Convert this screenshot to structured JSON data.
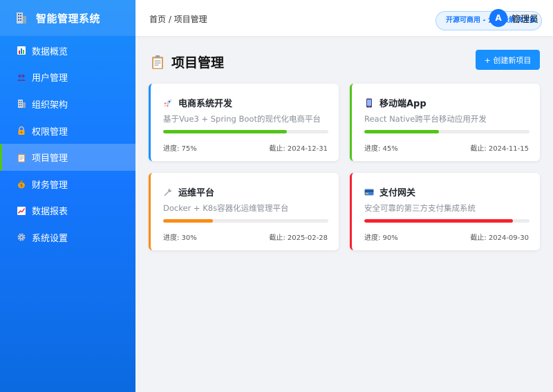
{
  "sidebar": {
    "title": "智能管理系统",
    "items": [
      {
        "label": "数据概览",
        "icon": "bar-chart-icon",
        "active": false
      },
      {
        "label": "用户管理",
        "icon": "users-icon",
        "active": false
      },
      {
        "label": "组织架构",
        "icon": "building-icon",
        "active": false
      },
      {
        "label": "权限管理",
        "icon": "lock-icon",
        "active": false
      },
      {
        "label": "项目管理",
        "icon": "clipboard-icon",
        "active": true
      },
      {
        "label": "财务管理",
        "icon": "money-bag-icon",
        "active": false
      },
      {
        "label": "数据报表",
        "icon": "line-chart-icon",
        "active": false
      },
      {
        "label": "系统设置",
        "icon": "gear-icon",
        "active": false
      }
    ]
  },
  "header": {
    "breadcrumb": "首页 / 项目管理",
    "license_badge": "开源可商用 - 企业级解决方案",
    "avatar_letter": "A",
    "user_name": "管理员"
  },
  "page": {
    "title": "项目管理",
    "create_button": "+ 创建新项目"
  },
  "projects": [
    {
      "title": "电商系统开发",
      "icon": "rocket-icon",
      "description": "基于Vue3 + Spring Boot的现代化电商平台",
      "progress": 75,
      "progress_label": "进度: 75%",
      "deadline_label": "截止: 2024-12-31",
      "color": "#1890ff",
      "bar_color": "#52c41a"
    },
    {
      "title": "移动端App",
      "icon": "mobile-phone-icon",
      "description": "React Native跨平台移动应用开发",
      "progress": 45,
      "progress_label": "进度: 45%",
      "deadline_label": "截止: 2024-11-15",
      "color": "#52c41a",
      "bar_color": "#52c41a"
    },
    {
      "title": "运维平台",
      "icon": "wrench-icon",
      "description": "Docker + K8s容器化运维管理平台",
      "progress": 30,
      "progress_label": "进度: 30%",
      "deadline_label": "截止: 2025-02-28",
      "color": "#fa8c16",
      "bar_color": "#fa8c16"
    },
    {
      "title": "支付网关",
      "icon": "credit-card-icon",
      "description": "安全可靠的第三方支付集成系统",
      "progress": 90,
      "progress_label": "进度: 90%",
      "deadline_label": "截止: 2024-09-30",
      "color": "#f5222d",
      "bar_color": "#f5222d"
    }
  ]
}
